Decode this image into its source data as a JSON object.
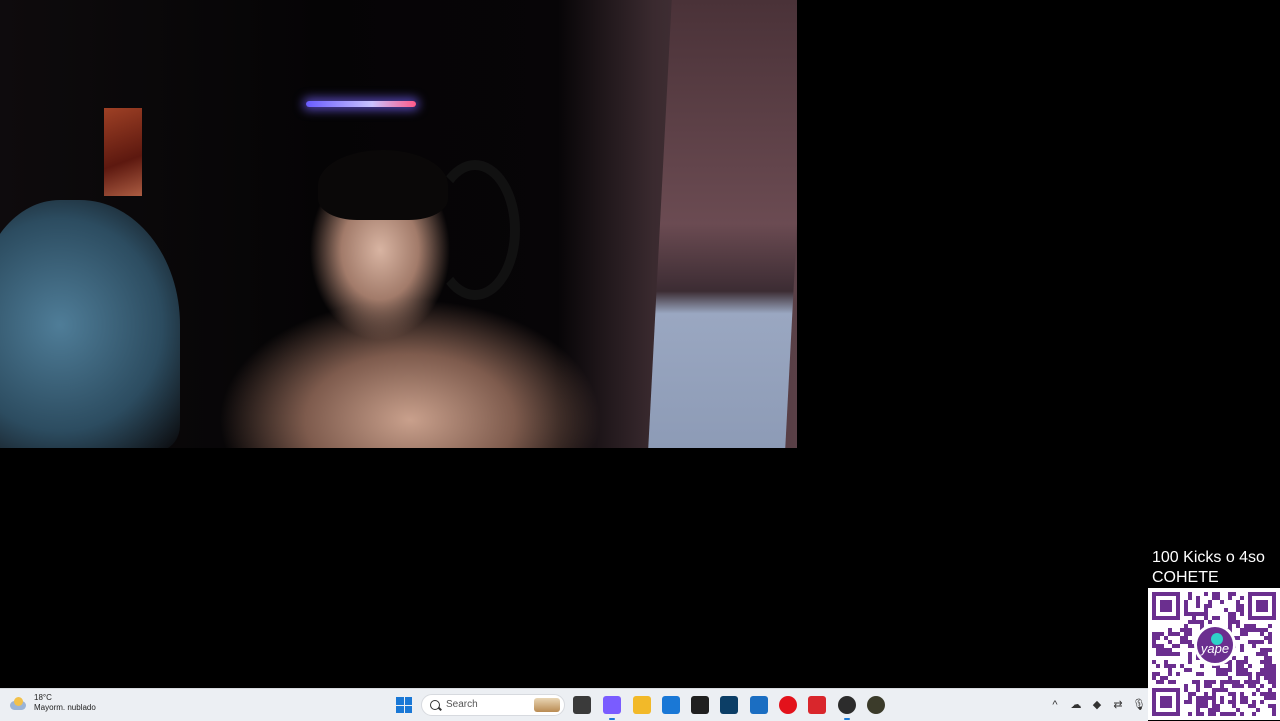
{
  "webcam": {
    "description_hidden": ""
  },
  "overlay": {
    "line1": "100 Kicks o 4so",
    "line2": "COHETE",
    "qr_brand": "yape",
    "qr_brand_color": "#6b2f8f"
  },
  "taskbar": {
    "weather": {
      "temp": "18°C",
      "condition": "Mayorm. nublado",
      "icon": "partly-cloudy-icon"
    },
    "search": {
      "placeholder": "Search"
    },
    "pinned": [
      {
        "name": "task-view-icon",
        "color": "#3a3a3a"
      },
      {
        "name": "copilot-icon",
        "color": "#7a5cff"
      },
      {
        "name": "file-explorer-icon",
        "color": "#f2b929"
      },
      {
        "name": "microsoft-store-icon",
        "color": "#1a78d6"
      },
      {
        "name": "dropbox-icon",
        "color": "#1f1f1f"
      },
      {
        "name": "terminal-icon",
        "color": "#0c3e66"
      },
      {
        "name": "outlook-icon",
        "color": "#1b6ec2"
      },
      {
        "name": "opera-icon",
        "color": "#e3121b"
      },
      {
        "name": "wps-office-icon",
        "color": "#d9262c"
      },
      {
        "name": "obs-studio-icon",
        "color": "#2c2c2c"
      },
      {
        "name": "steam-app-icon",
        "color": "#3b3b2a"
      }
    ],
    "tray": [
      {
        "name": "show-hidden-icons-chevron",
        "glyph": "^"
      },
      {
        "name": "cloud-sync-off-icon",
        "glyph": "☁"
      },
      {
        "name": "nvidia-icon",
        "glyph": "◆"
      },
      {
        "name": "network-icon",
        "glyph": "⇄"
      },
      {
        "name": "microphone-icon",
        "glyph": "🎙"
      }
    ]
  }
}
